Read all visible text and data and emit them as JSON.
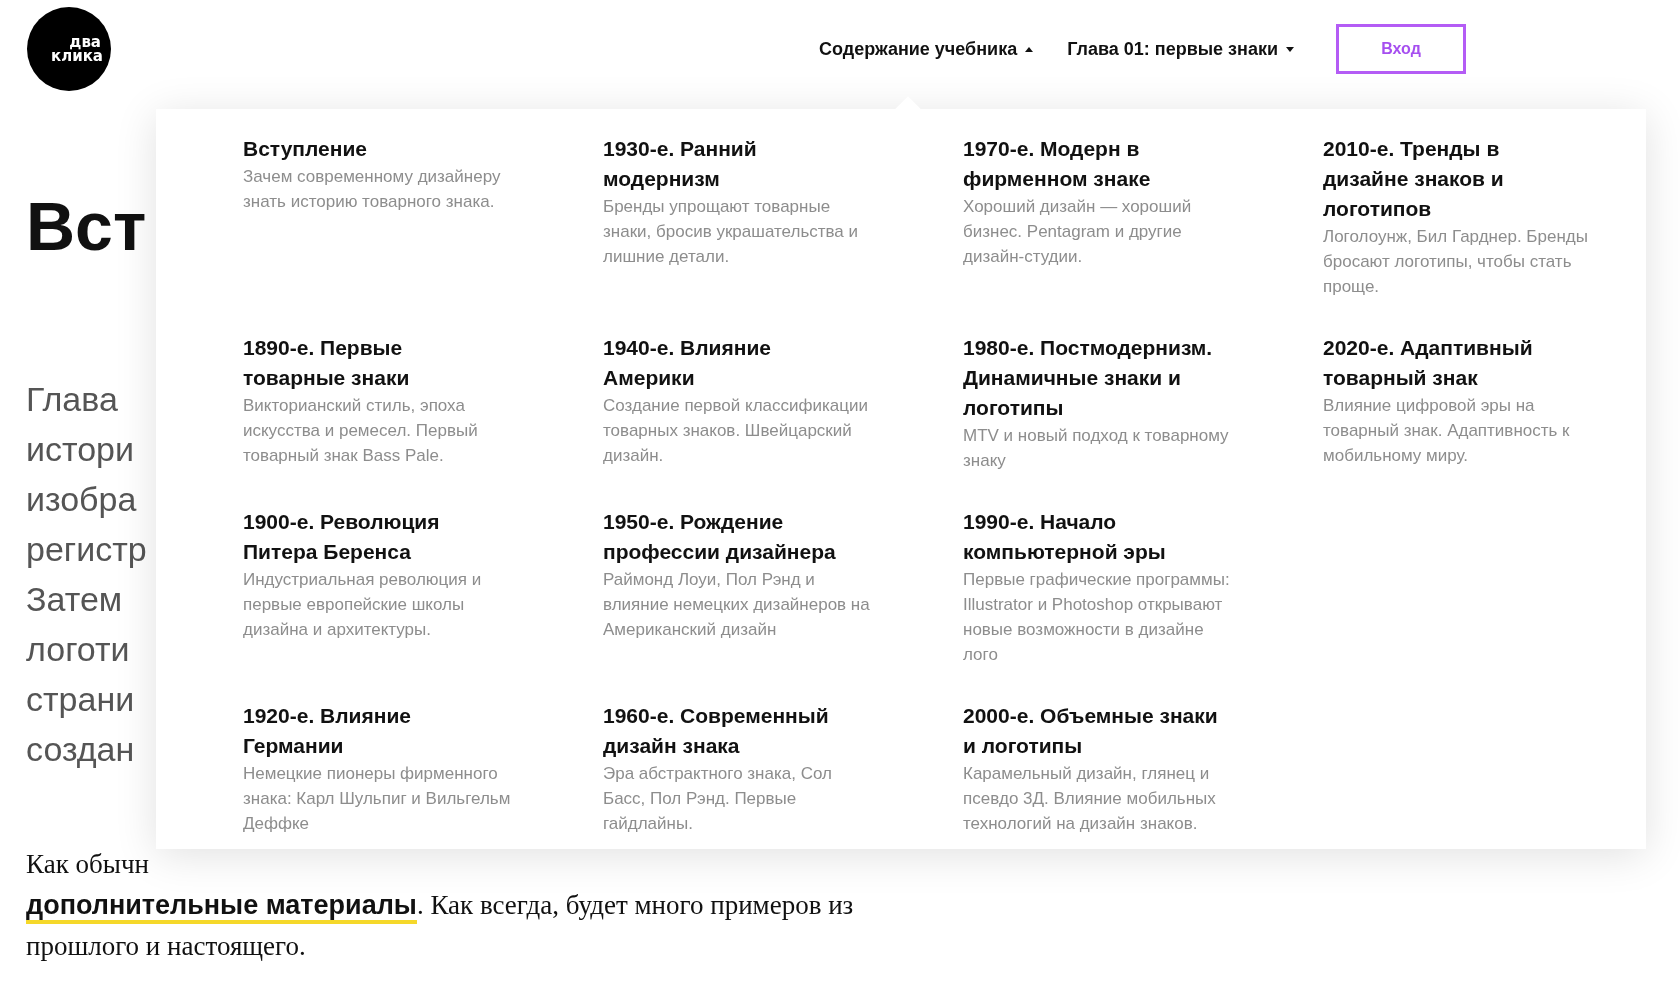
{
  "logo": {
    "text": "два клика"
  },
  "nav": [
    {
      "label": "Содержание учебника",
      "expanded": true
    },
    {
      "label": "Глава 01: первые знаки",
      "expanded": false
    }
  ],
  "login_button": "Вход",
  "article": {
    "heading": "Вст",
    "intro_lines": [
      "Глава",
      "истори",
      "изобра",
      "регистр",
      "Затем",
      "логоти",
      "страни",
      "создан"
    ],
    "paragraph": {
      "first_line": "Как обычн",
      "link": "дополнительные материалы",
      "rest": ". Как всегда, будет много примеров из прошлого и настоящего."
    }
  },
  "contents_menu": {
    "columns": [
      [
        {
          "title": "Вступление",
          "description": "Зачем современному дизайнеру знать историю товарного знака."
        },
        {
          "title": "1890-е. Первые товарные знаки",
          "description": "Викторианский стиль, эпоха искусства и ремесел. Первый товарный знак Bass Pale."
        },
        {
          "title": "1900-е. Революция Питера Беренса",
          "description": "Индустриальная революция и первые европейские школы дизайна и архитектуры."
        },
        {
          "title": "1920-е. Влияние Германии",
          "description": "Немецкие пионеры фирменного знака: Карл Шульпиг и Вильгельм Деффке"
        }
      ],
      [
        {
          "title": "1930-е. Ранний модернизм",
          "description": "Бренды упрощают товарные знаки, бросив украшательства и лишние детали."
        },
        {
          "title": "1940-е. Влияние Америки",
          "description": "Создание первой классификации товарных знаков. Швейцарский дизайн."
        },
        {
          "title": "1950-е. Рождение профессии дизайнера",
          "description": "Раймонд Лоуи, Пол Рэнд и влияние немецких дизайнеров на Американский дизайн"
        },
        {
          "title": "1960-е. Современный дизайн знака",
          "description": "Эра абстрактного знака, Сол Басс, Пол Рэнд. Первые гайдлайны."
        }
      ],
      [
        {
          "title": "1970-е. Модерн в фирменном знаке",
          "description": "Хороший дизайн — хороший бизнес. Pentagram и другие дизайн-студии."
        },
        {
          "title": "1980-е. Постмодернизм. Динамичные знаки и логотипы",
          "description": "MTV и новый подход к товарному знаку"
        },
        {
          "title": "1990-е. Начало компьютерной эры",
          "description": "Первые графические программы: Illustrator и Photoshop открывают новые возможности в дизайне лого"
        },
        {
          "title": "2000-е. Объемные знаки и логотипы",
          "description": "Карамельный дизайн, глянец и псевдо 3Д. Влияние мобильных технологий на дизайн знаков."
        }
      ],
      [
        {
          "title": "2010-е. Тренды в дизайне знаков и логотипов",
          "description": "Логолоунж, Бил Гарднер. Бренды бросают логотипы, чтобы стать проще."
        },
        {
          "title": "2020-е. Адаптивный товарный знак",
          "description": "Влияние цифровой эры на товарный знак. Адаптивность к мобильному миру."
        }
      ]
    ]
  }
}
